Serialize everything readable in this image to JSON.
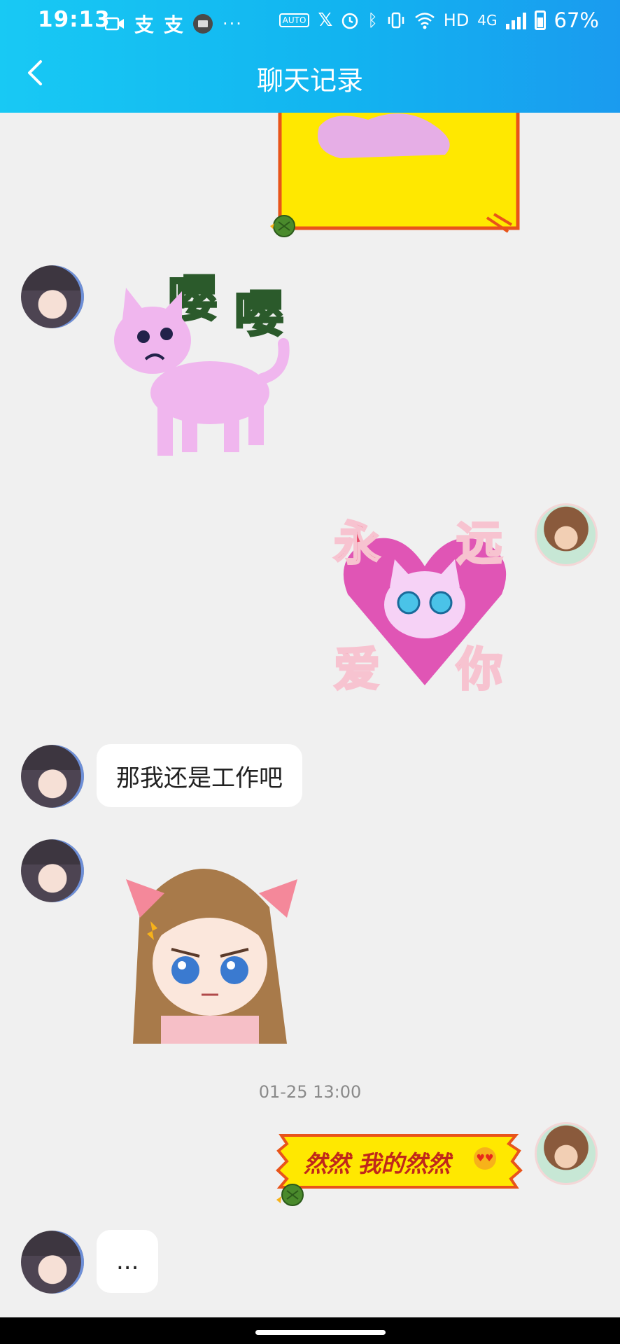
{
  "status_bar": {
    "time": "19:13",
    "network": "HD",
    "network_type": "4G",
    "battery": "67%"
  },
  "header": {
    "title": "聊天记录",
    "background_color": "#18c9f4"
  },
  "messages": [
    {
      "side": "right",
      "type": "sticker",
      "sticker": "yellow-frame-sticker"
    },
    {
      "side": "left",
      "type": "sticker",
      "sticker": "pink-cat-sticker",
      "text": "嘤嘤"
    },
    {
      "side": "right",
      "type": "sticker",
      "sticker": "forever-love-you-sticker",
      "text": [
        "永",
        "远",
        "爱",
        "你"
      ]
    },
    {
      "side": "left",
      "type": "text",
      "text": "那我还是工作吧"
    },
    {
      "side": "left",
      "type": "sticker",
      "sticker": "angry-girl-sticker"
    },
    {
      "side": "center",
      "type": "timestamp",
      "text": "01-25 13:00"
    },
    {
      "side": "right",
      "type": "banner",
      "text": "然然 我的然然"
    },
    {
      "side": "left",
      "type": "text",
      "text": "..."
    }
  ]
}
